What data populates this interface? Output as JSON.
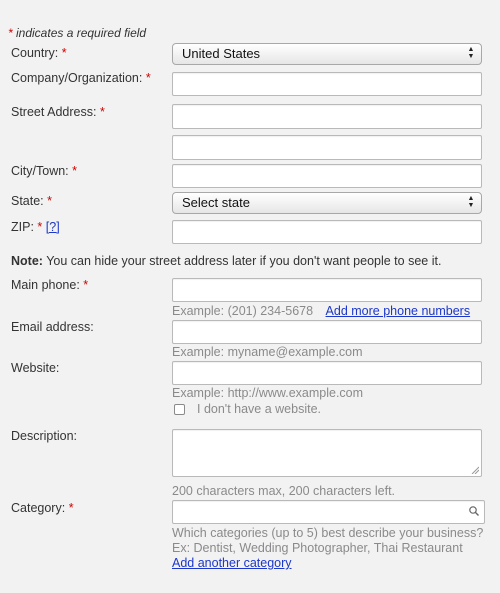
{
  "required_note": {
    "star": "*",
    "text": " indicates a required field"
  },
  "fields": {
    "country": {
      "label": "Country:",
      "star": "*",
      "value": "United States"
    },
    "company": {
      "label": "Company/Organization:",
      "star": "*"
    },
    "street": {
      "label": "Street Address:",
      "star": "*"
    },
    "city": {
      "label": "City/Town:",
      "star": "*"
    },
    "state": {
      "label": "State:",
      "star": "*",
      "value": "Select state"
    },
    "zip": {
      "label": "ZIP:",
      "star": "*",
      "help": "[?]"
    },
    "phone": {
      "label": "Main phone:",
      "star": "*",
      "hint": "Example: (201) 234-5678",
      "add_link": "Add more phone numbers"
    },
    "email": {
      "label": "Email address:",
      "hint": "Example: myname@example.com"
    },
    "website": {
      "label": "Website:",
      "hint": "Example: http://www.example.com",
      "checkbox_label": "I don't have a website."
    },
    "description": {
      "label": "Description:",
      "hint": "200 characters max, 200 characters left."
    },
    "category": {
      "label": "Category:",
      "star": "*",
      "hint1": "Which categories (up to 5) best describe your business?",
      "hint2": "Ex: Dentist, Wedding Photographer, Thai Restaurant",
      "add_link": "Add another category"
    }
  },
  "note": {
    "bold": "Note:",
    "text": " You can hide your street address later if you don't want people to see it."
  }
}
